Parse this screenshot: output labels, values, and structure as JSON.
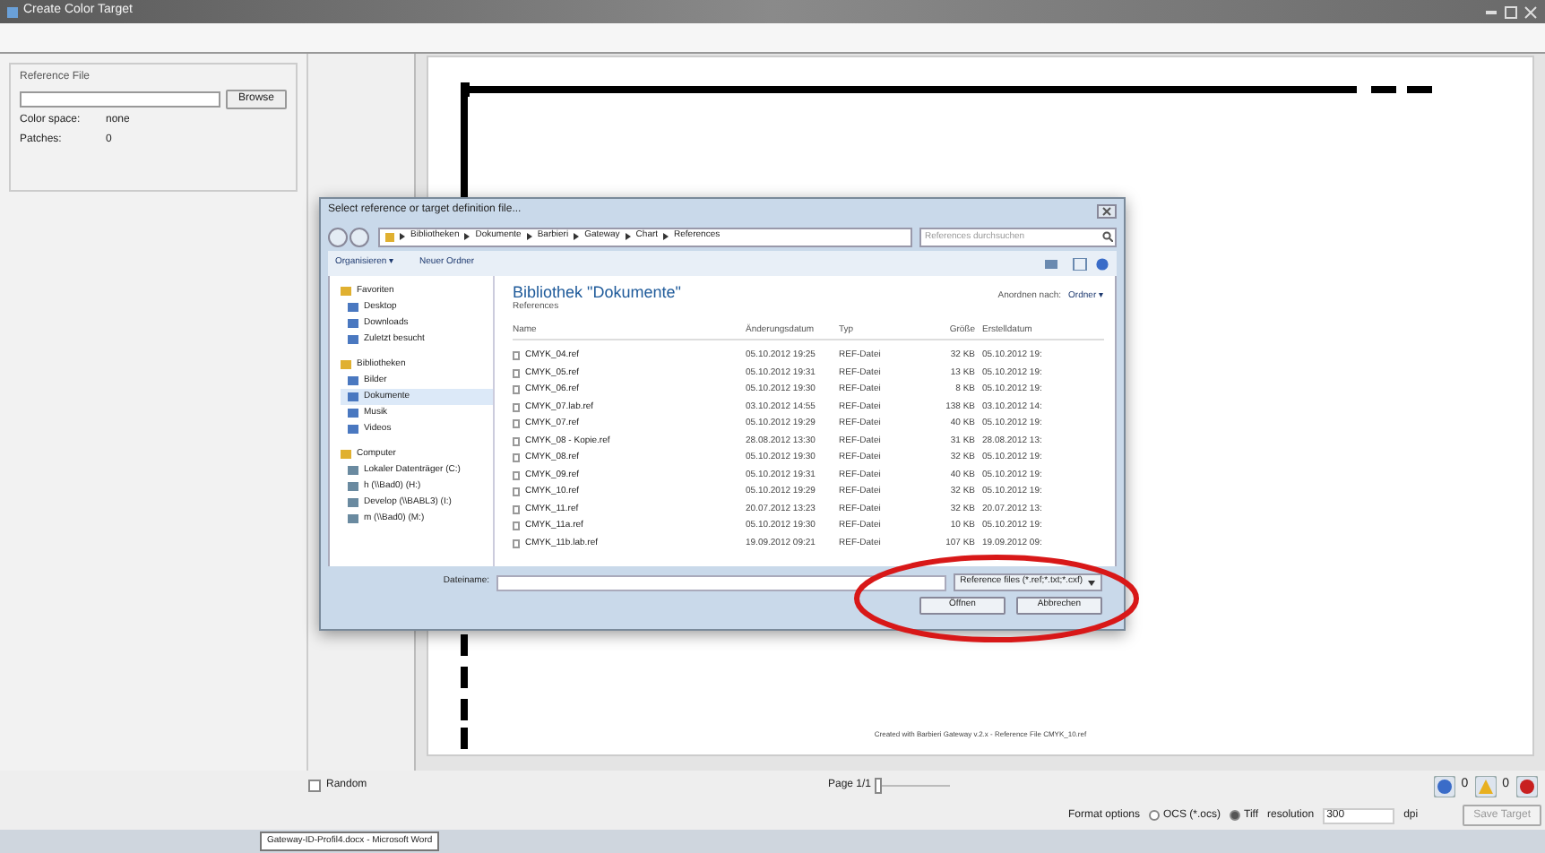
{
  "window": {
    "title": "Create Color Target"
  },
  "reference_panel": {
    "group_title": "Reference File",
    "browse_button": "Browse",
    "color_space_label": "Color space:",
    "color_space_value": "none",
    "patches_label": "Patches:",
    "patches_value": "0"
  },
  "page_preview": {
    "footer": "Created with Barbieri Gateway v.2.x - Reference File CMYK_10.ref"
  },
  "dialog": {
    "title": "Select reference or target definition file...",
    "path": [
      "Bibliotheken",
      "Dokumente",
      "Barbieri",
      "Gateway",
      "Chart",
      "References"
    ],
    "search_placeholder": "References durchsuchen",
    "organize": "Organisieren ▾",
    "new_folder": "Neuer Ordner",
    "nav": [
      {
        "label": "Favoriten",
        "kind": "header",
        "selected": false
      },
      {
        "label": "Desktop",
        "kind": "item",
        "selected": false
      },
      {
        "label": "Downloads",
        "kind": "item",
        "selected": false
      },
      {
        "label": "Zuletzt besucht",
        "kind": "item",
        "selected": false
      },
      {
        "label": "Bibliotheken",
        "kind": "header",
        "selected": false
      },
      {
        "label": "Bilder",
        "kind": "item",
        "selected": false
      },
      {
        "label": "Dokumente",
        "kind": "item",
        "selected": true
      },
      {
        "label": "Musik",
        "kind": "item",
        "selected": false
      },
      {
        "label": "Videos",
        "kind": "item",
        "selected": false
      },
      {
        "label": "Computer",
        "kind": "header",
        "selected": false
      },
      {
        "label": "Lokaler Datenträger (C:)",
        "kind": "drive",
        "selected": false
      },
      {
        "label": "h (\\\\Bad0) (H:)",
        "kind": "drive",
        "selected": false
      },
      {
        "label": "Develop (\\\\BABL3) (I:)",
        "kind": "drive",
        "selected": false
      },
      {
        "label": "m (\\\\Bad0) (M:)",
        "kind": "drive",
        "selected": false
      }
    ],
    "library_title": "Bibliothek \"Dokumente\"",
    "library_subtitle": "References",
    "arrange_label": "Anordnen nach:",
    "arrange_value": "Ordner ▾",
    "columns": [
      "Name",
      "Änderungsdatum",
      "Typ",
      "Größe",
      "Erstelldatum"
    ],
    "rows": [
      {
        "name": "CMYK_04.ref",
        "date": "05.10.2012 19:25",
        "type": "REF-Datei",
        "size": "32 KB",
        "created": "05.10.2012 19:"
      },
      {
        "name": "CMYK_05.ref",
        "date": "05.10.2012 19:31",
        "type": "REF-Datei",
        "size": "13 KB",
        "created": "05.10.2012 19:"
      },
      {
        "name": "CMYK_06.ref",
        "date": "05.10.2012 19:30",
        "type": "REF-Datei",
        "size": "8 KB",
        "created": "05.10.2012 19:"
      },
      {
        "name": "CMYK_07.lab.ref",
        "date": "03.10.2012 14:55",
        "type": "REF-Datei",
        "size": "138 KB",
        "created": "03.10.2012 14:"
      },
      {
        "name": "CMYK_07.ref",
        "date": "05.10.2012 19:29",
        "type": "REF-Datei",
        "size": "40 KB",
        "created": "05.10.2012 19:"
      },
      {
        "name": "CMYK_08 - Kopie.ref",
        "date": "28.08.2012 13:30",
        "type": "REF-Datei",
        "size": "31 KB",
        "created": "28.08.2012 13:"
      },
      {
        "name": "CMYK_08.ref",
        "date": "05.10.2012 19:30",
        "type": "REF-Datei",
        "size": "32 KB",
        "created": "05.10.2012 19:"
      },
      {
        "name": "CMYK_09.ref",
        "date": "05.10.2012 19:31",
        "type": "REF-Datei",
        "size": "40 KB",
        "created": "05.10.2012 19:"
      },
      {
        "name": "CMYK_10.ref",
        "date": "05.10.2012 19:29",
        "type": "REF-Datei",
        "size": "32 KB",
        "created": "05.10.2012 19:"
      },
      {
        "name": "CMYK_11.ref",
        "date": "20.07.2012 13:23",
        "type": "REF-Datei",
        "size": "32 KB",
        "created": "20.07.2012 13:"
      },
      {
        "name": "CMYK_11a.ref",
        "date": "05.10.2012 19:30",
        "type": "REF-Datei",
        "size": "10 KB",
        "created": "05.10.2012 19:"
      },
      {
        "name": "CMYK_11b.lab.ref",
        "date": "19.09.2012 09:21",
        "type": "REF-Datei",
        "size": "107 KB",
        "created": "19.09.2012 09:"
      }
    ],
    "filename_label": "Dateiname:",
    "filter": "Reference files (*.ref;*.txt;*.cxf)",
    "buttons": [
      "Öffnen",
      "Abbrechen"
    ]
  },
  "bottom": {
    "random": {
      "label": "Random",
      "checked": false
    },
    "page_label": "Page 1/1",
    "page_slider": {
      "level": 0
    },
    "status": [
      {
        "kind": "info",
        "count": "0"
      },
      {
        "kind": "warning",
        "count": "0"
      },
      {
        "kind": "error"
      }
    ],
    "format_label": "Format options",
    "format_options": [
      {
        "label": "OCS (*.ocs)",
        "selected": false
      },
      {
        "label": "Tiff",
        "selected": true
      }
    ],
    "resolution_label": "resolution",
    "resolution_value": "300",
    "dpi_label": "dpi",
    "save_button": {
      "label": "Save Target",
      "disabled": true
    }
  },
  "taskbar": {
    "tooltip": "Gateway-ID-Profil4.docx - Microsoft Word"
  }
}
